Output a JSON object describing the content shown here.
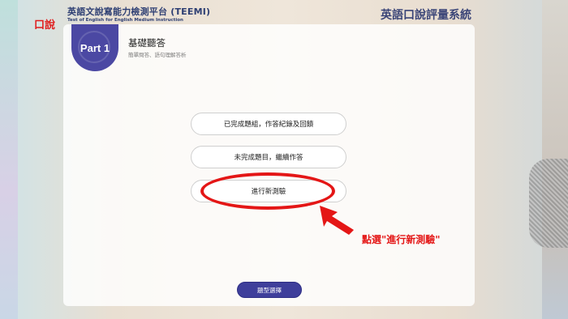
{
  "header": {
    "corner_label": "口說",
    "brand_title": "英語文說寫能力檢測平台 (TEEMI)",
    "brand_subtitle": "Test of English for English Medium Instruction",
    "system_title": "英語口說評量系統"
  },
  "section": {
    "badge": "Part 1",
    "title": "基礎聽答",
    "subtitle": "簡單問答、語句理解答析"
  },
  "menu": {
    "items": [
      {
        "label": "已完成題組，作答紀錄及回饋"
      },
      {
        "label": "未完成題目，繼續作答"
      },
      {
        "label": "進行新測驗"
      }
    ],
    "type_select_label": "題型選擇"
  },
  "annotation": {
    "text": "點選\"進行新測驗\"",
    "color": "#e41616"
  },
  "colors": {
    "brand_navy": "#2e3f73",
    "badge_purple": "#4b48a3",
    "button_purple": "#3f3f9b"
  }
}
